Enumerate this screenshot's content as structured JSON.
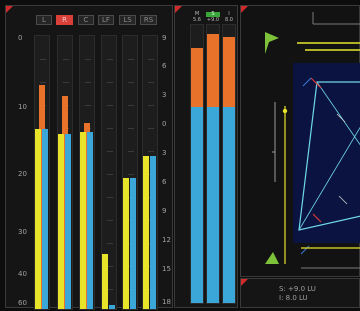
{
  "channel_meters": {
    "tabs": [
      {
        "label": "L",
        "active": false
      },
      {
        "label": "R",
        "active": true
      },
      {
        "label": "C",
        "active": false
      },
      {
        "label": "LF",
        "active": false
      },
      {
        "label": "LS",
        "active": false
      },
      {
        "label": "RS",
        "active": false
      }
    ],
    "left_scale": [
      "0",
      "10",
      "20",
      "30",
      "40",
      "60"
    ],
    "right_scale": [
      "9",
      "6",
      "3",
      "0",
      "3",
      "6",
      "9",
      "12",
      "15",
      "18"
    ],
    "channels": [
      {
        "level": 0.66,
        "peak_hold": 0.82
      },
      {
        "level": 0.64,
        "peak_hold": 0.78
      },
      {
        "level": 0.65,
        "peak_hold": 0.68
      },
      {
        "level": 0.2,
        "peak_hold": 0.2
      },
      {
        "level": 0.48,
        "peak_hold": 0.48
      },
      {
        "level": 0.56,
        "peak_hold": 0.56
      }
    ],
    "colors": {
      "level": "#e8e42a",
      "peak": "#e8722a",
      "low_floor": "#3ba6d8"
    }
  },
  "loudness_meters": {
    "labels": [
      {
        "title": "M",
        "value": "5.6"
      },
      {
        "title": "S",
        "value": "+9.0"
      },
      {
        "title": "I",
        "value": "8.0"
      }
    ],
    "bars": [
      {
        "blue_fraction": 0.7,
        "orange_fraction": 0.21
      },
      {
        "blue_fraction": 0.7,
        "orange_fraction": 0.26
      },
      {
        "blue_fraction": 0.7,
        "orange_fraction": 0.25
      }
    ],
    "colors": {
      "blue": "#3ba6d8",
      "orange": "#e8722a",
      "active_label": "#3aa63a"
    }
  },
  "surround_scope": {
    "colors": {
      "frame": "#6fd8e8",
      "lines": "#e8e42a",
      "arrow": "#7ec23a",
      "accent": "#d83a3a"
    }
  },
  "status_bar": {
    "short_term": "S: +9.0   LU",
    "integrated": "I:  8.0   LU"
  }
}
